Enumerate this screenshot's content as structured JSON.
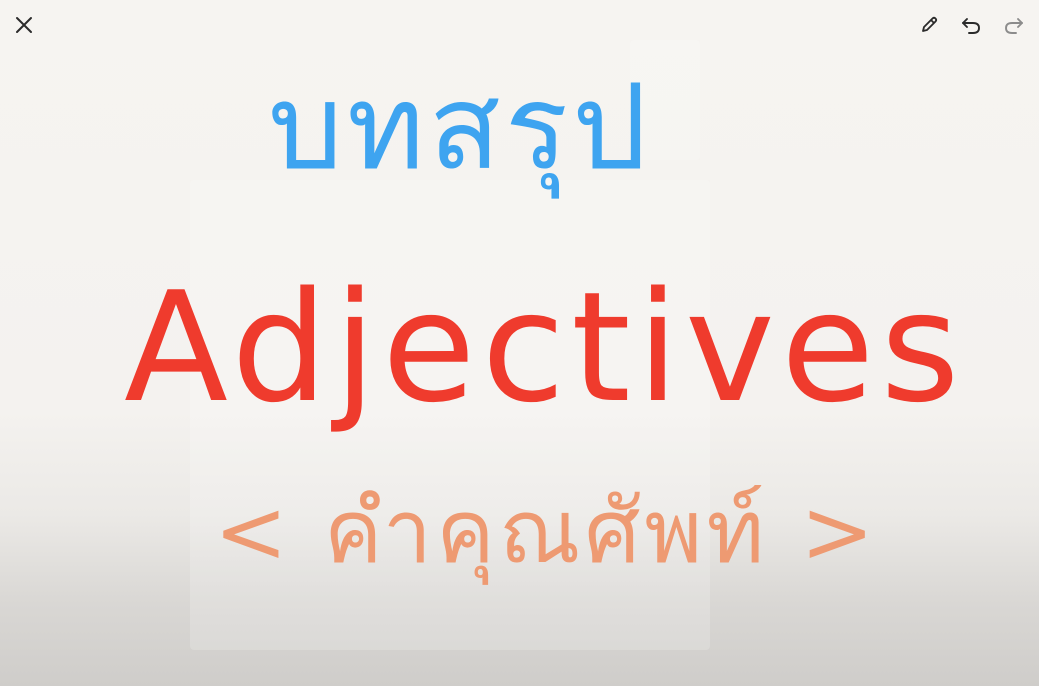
{
  "toolbar": {
    "close": {
      "icon": "close-icon"
    },
    "pen": {
      "icon": "pencil-icon"
    },
    "undo": {
      "icon": "undo-icon"
    },
    "redo": {
      "icon": "redo-icon",
      "enabled": false
    }
  },
  "board": {
    "title_thai": "บทสรุป",
    "title_en": "Adjectives",
    "subtitle": "< คำคุณศัพท์ >"
  },
  "colors": {
    "title_thai": "#3ea4f0",
    "title_en": "#ef3b2d",
    "subtitle": "#ee9a72",
    "icon": "#2b2b2b",
    "icon_disabled": "#8c8c8c"
  }
}
